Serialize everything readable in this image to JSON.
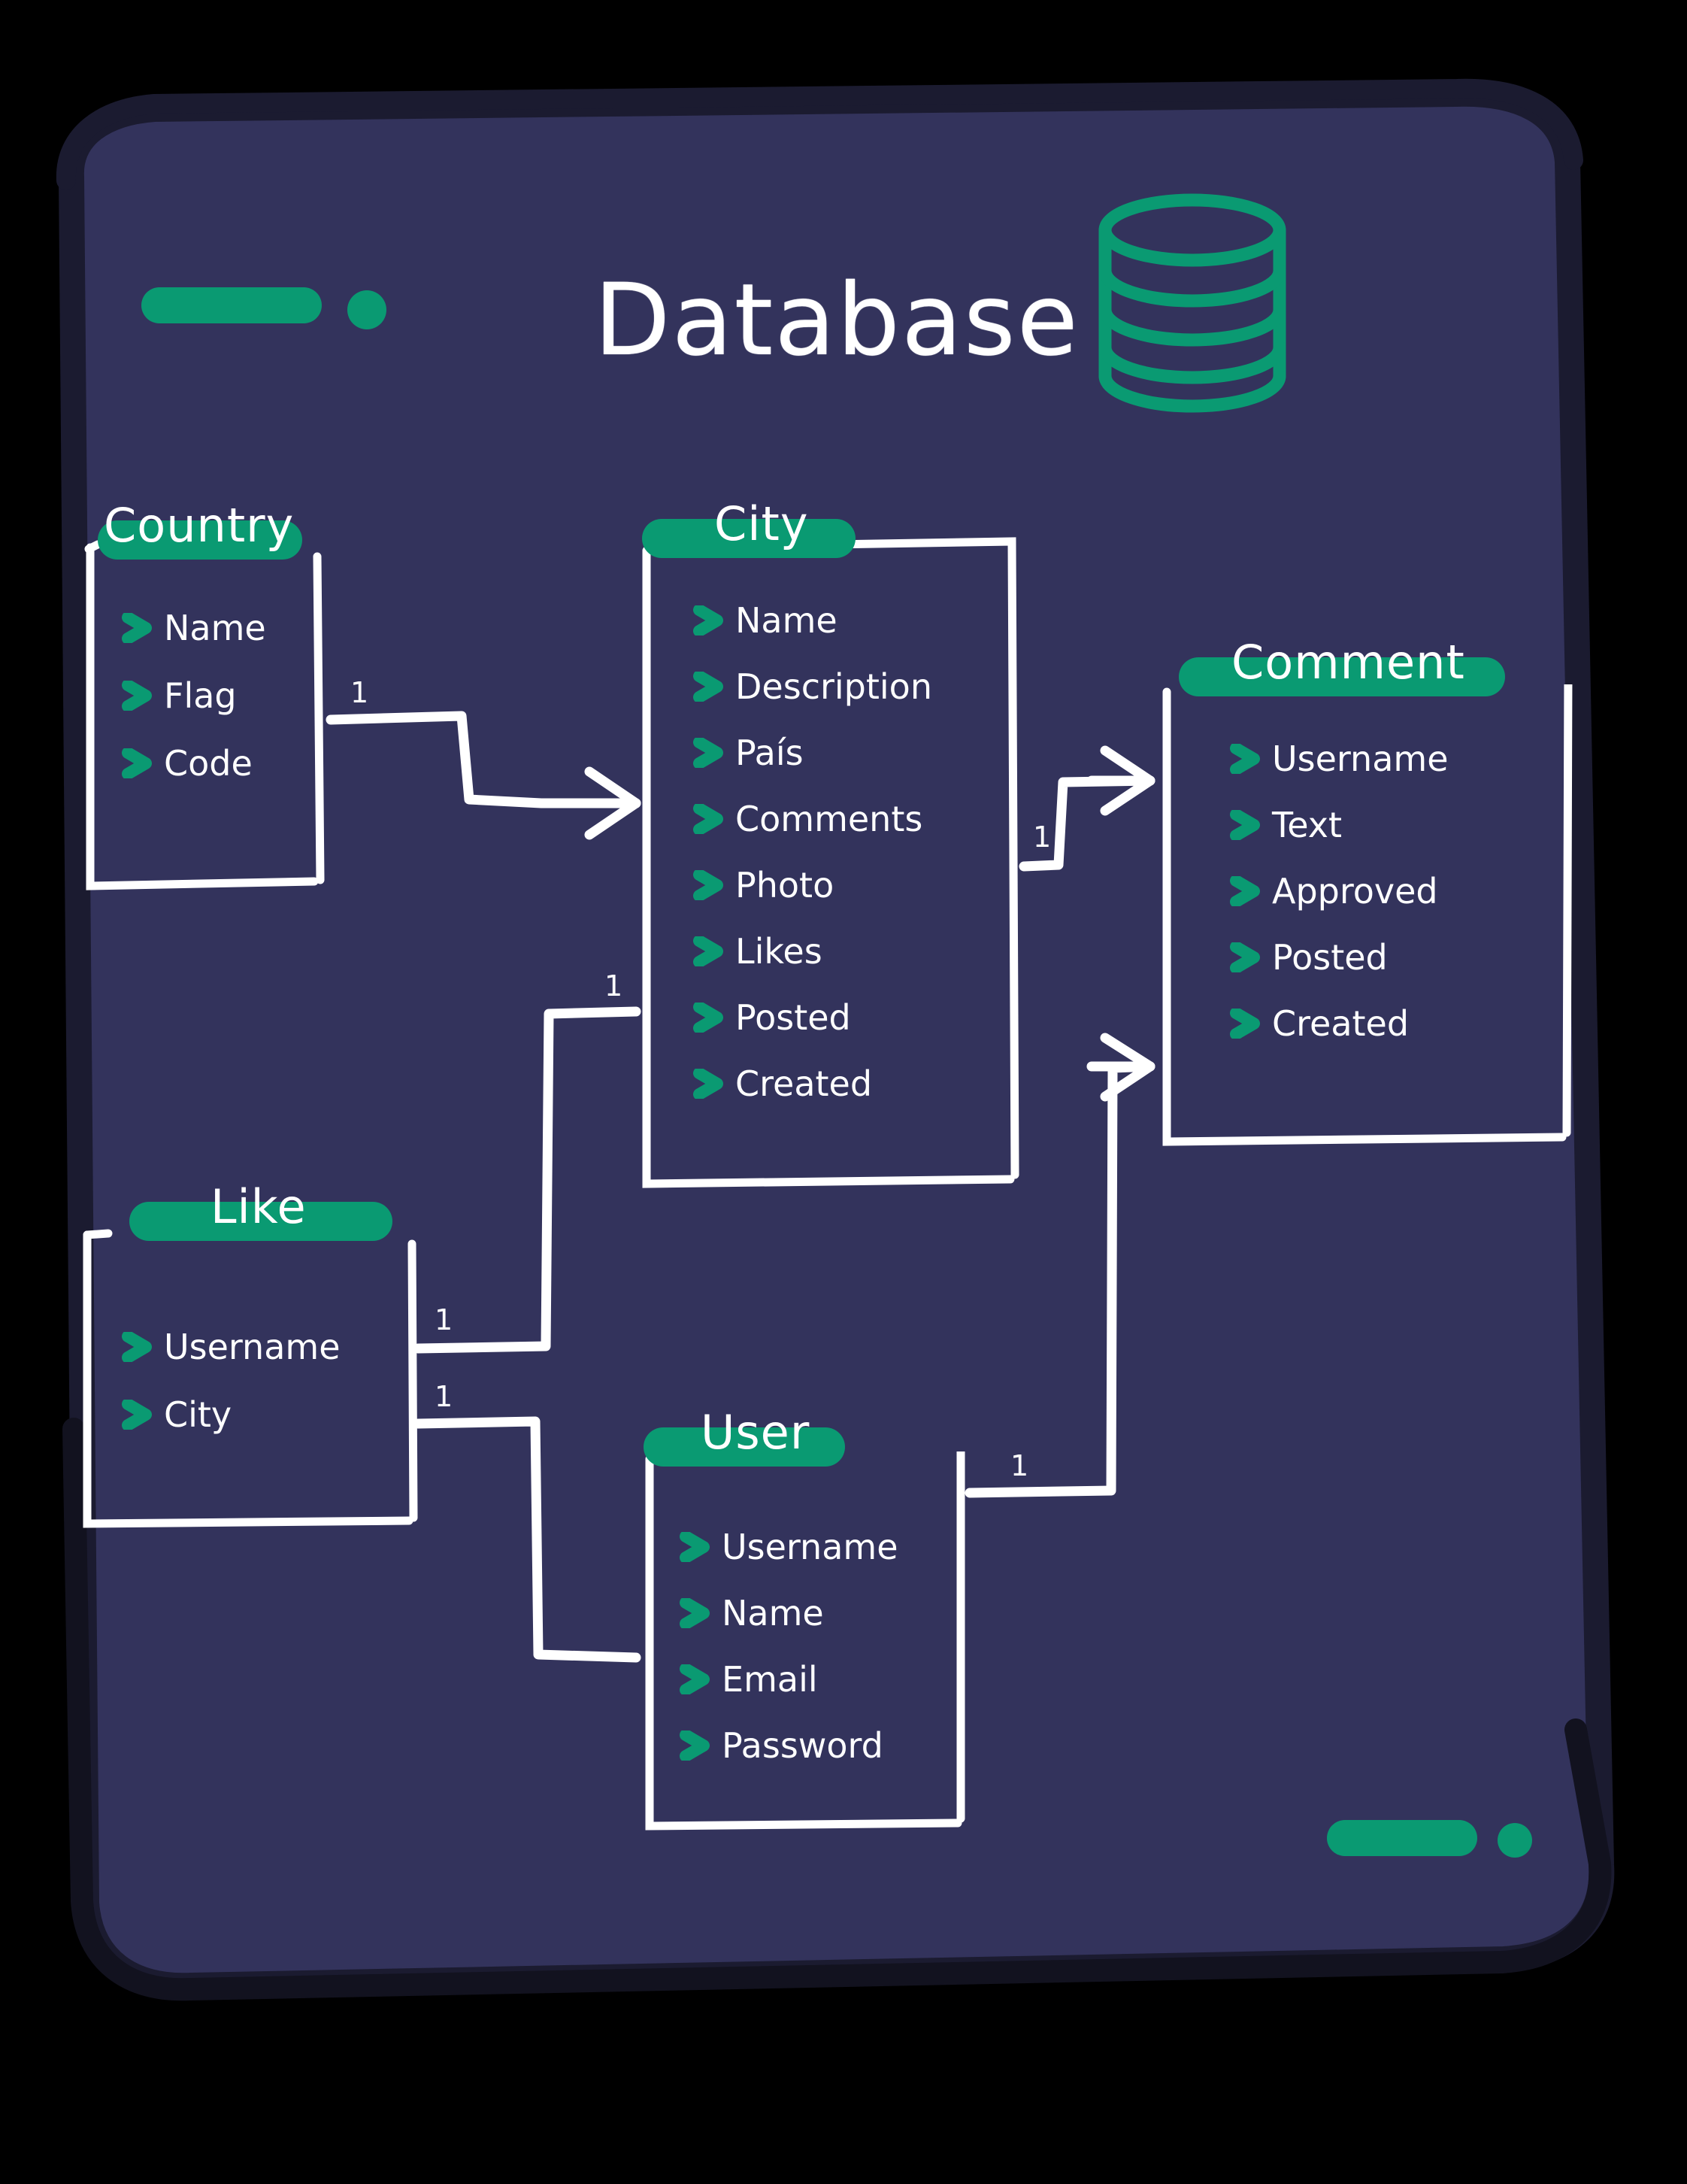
{
  "page": {
    "background_color": "#000000",
    "panel_color": "#33335c",
    "panel_border_color": "#1b1b30",
    "accent_color": "#0a9a72",
    "ink_color": "#ffffff"
  },
  "header": {
    "title": "Database",
    "icon": "database-cylinder-icon"
  },
  "decorations": {
    "top_left": {
      "pill": "deco-pill",
      "dot": "deco-dot"
    },
    "bottom_right": {
      "pill": "deco-pill",
      "dot": "deco-dot"
    }
  },
  "chart_data": {
    "type": "diagram",
    "diagram_kind": "entity-relationship",
    "notation": "crow's foot",
    "title": "Database",
    "entities": [
      {
        "name": "Country",
        "fields": [
          "Name",
          "Flag",
          "Code"
        ]
      },
      {
        "name": "City",
        "fields": [
          "Name",
          "Description",
          "País",
          "Comments",
          "Photo",
          "Likes",
          "Posted",
          "Created"
        ]
      },
      {
        "name": "Comment",
        "fields": [
          "Username",
          "Text",
          "Approved",
          "Posted",
          "Created"
        ]
      },
      {
        "name": "Like",
        "fields": [
          "Username",
          "City"
        ]
      },
      {
        "name": "User",
        "fields": [
          "Username",
          "Name",
          "Email",
          "Password"
        ]
      }
    ],
    "relationships": [
      {
        "from": "Country",
        "to": "City",
        "from_cardinality": "1",
        "to_cardinality": "many"
      },
      {
        "from": "City",
        "to": "Comment",
        "from_cardinality": "1",
        "to_cardinality": "many"
      },
      {
        "from": "Like",
        "to": "City",
        "from_cardinality": "1",
        "to_cardinality": "1"
      },
      {
        "from": "Like",
        "to": "User",
        "from_cardinality": "1",
        "to_cardinality": "1"
      },
      {
        "from": "User",
        "to": "Comment",
        "from_cardinality": "1",
        "to_cardinality": "many"
      }
    ],
    "cardinality_labels": [
      "1",
      "1",
      "1",
      "1",
      "1",
      "1"
    ]
  },
  "entities": {
    "country": {
      "title": "Country",
      "fields": [
        "Name",
        "Flag",
        "Code"
      ]
    },
    "city": {
      "title": "City",
      "fields": [
        "Name",
        "Description",
        "País",
        "Comments",
        "Photo",
        "Likes",
        "Posted",
        "Created"
      ]
    },
    "comment": {
      "title": "Comment",
      "fields": [
        "Username",
        "Text",
        "Approved",
        "Posted",
        "Created"
      ]
    },
    "like": {
      "title": "Like",
      "fields": [
        "Username",
        "City"
      ]
    },
    "user": {
      "title": "User",
      "fields": [
        "Username",
        "Name",
        "Email",
        "Password"
      ]
    }
  },
  "cardinalities": {
    "country_city": "1",
    "city_comment": "1",
    "like_city": "1",
    "like_user": "1",
    "user_comment": "1",
    "user_like": "1"
  }
}
